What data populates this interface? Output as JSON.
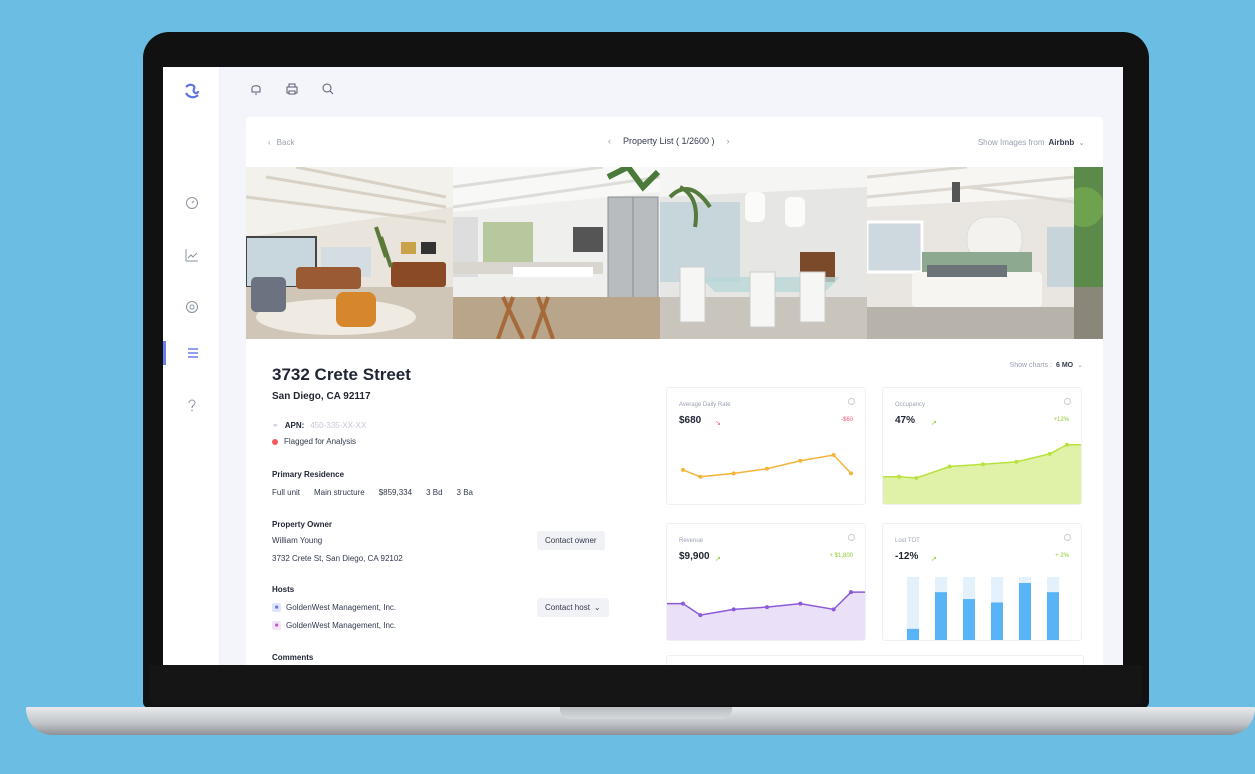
{
  "topbar": {
    "icons": [
      "bell-icon",
      "printer-icon",
      "search-icon"
    ]
  },
  "sidebar": {
    "items": [
      "dashboard-icon",
      "chart-icon",
      "location-icon",
      "list-icon",
      "help-icon"
    ],
    "active": "list-icon"
  },
  "header": {
    "back_label": "Back",
    "property_list": "Property List ( 1/2600 )",
    "show_images_label": "Show Images from",
    "show_images_value": "Airbnb"
  },
  "property": {
    "street": "3732 Crete Street",
    "city": "San Diego, CA 92117",
    "apn_label": "APN:",
    "apn_value": "450-335-XX-XX",
    "flag": "Flagged for Analysis",
    "residence": {
      "title": "Primary Residence",
      "unit": "Full unit",
      "structure": "Main structure",
      "price": "$859,334",
      "beds": "3 Bd",
      "baths": "3 Ba"
    },
    "owner": {
      "title": "Property Owner",
      "name": "William Young",
      "address": "3732 Crete St, San Diego, CA 92102",
      "contact_label": "Contact owner"
    },
    "hosts": {
      "title": "Hosts",
      "items": [
        "GoldenWest Management, Inc.",
        "GoldenWest Management, Inc."
      ],
      "contact_label": "Contact host"
    },
    "comments_title": "Comments"
  },
  "charts_control": {
    "label": "Show charts :",
    "value": "6 MO"
  },
  "chart_data": [
    {
      "type": "line",
      "title": "Average Daily Rate",
      "value": "$680",
      "change": "-$60",
      "values": [
        28,
        22,
        25,
        29,
        36,
        41,
        25
      ],
      "color": "#f4b43a"
    },
    {
      "type": "area",
      "title": "Occupancy",
      "value": "47%",
      "change": "+12%",
      "values": [
        22,
        21,
        31,
        33,
        35,
        42,
        50
      ],
      "color": "#b9e23e"
    },
    {
      "type": "area",
      "title": "Revenue",
      "value": "$9,900",
      "change": "+ $1,800",
      "values": [
        30,
        20,
        25,
        27,
        30,
        25,
        40
      ],
      "color": "#8c5ad8"
    },
    {
      "type": "bar",
      "title": "Lost TOT",
      "value": "-12%",
      "change": "+ 2%",
      "values": [
        8,
        40,
        34,
        31,
        48,
        40
      ],
      "color": "#58b4f6"
    }
  ]
}
